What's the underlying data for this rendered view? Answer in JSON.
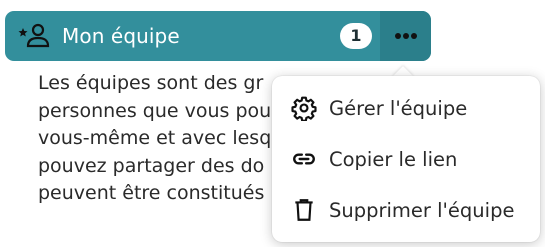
{
  "team": {
    "name": "Mon équipe",
    "member_count": "1",
    "icon": "team-person-star-icon",
    "more_icon": "more-horizontal-icon"
  },
  "description": {
    "lines": [
      "Les équipes sont des gr",
      "personnes que vous pou",
      "vous-même et avec lesq",
      "pouvez partager des do",
      "peuvent être constitués"
    ]
  },
  "menu": {
    "items": [
      {
        "label": "Gérer l'équipe",
        "icon": "gear-icon"
      },
      {
        "label": "Copier le lien",
        "icon": "link-icon"
      },
      {
        "label": "Supprimer l'équipe",
        "icon": "trash-icon"
      }
    ]
  },
  "colors": {
    "accent": "#338f9c",
    "accent_dark": "#2b7f8b",
    "text": "#2a2a2a"
  }
}
